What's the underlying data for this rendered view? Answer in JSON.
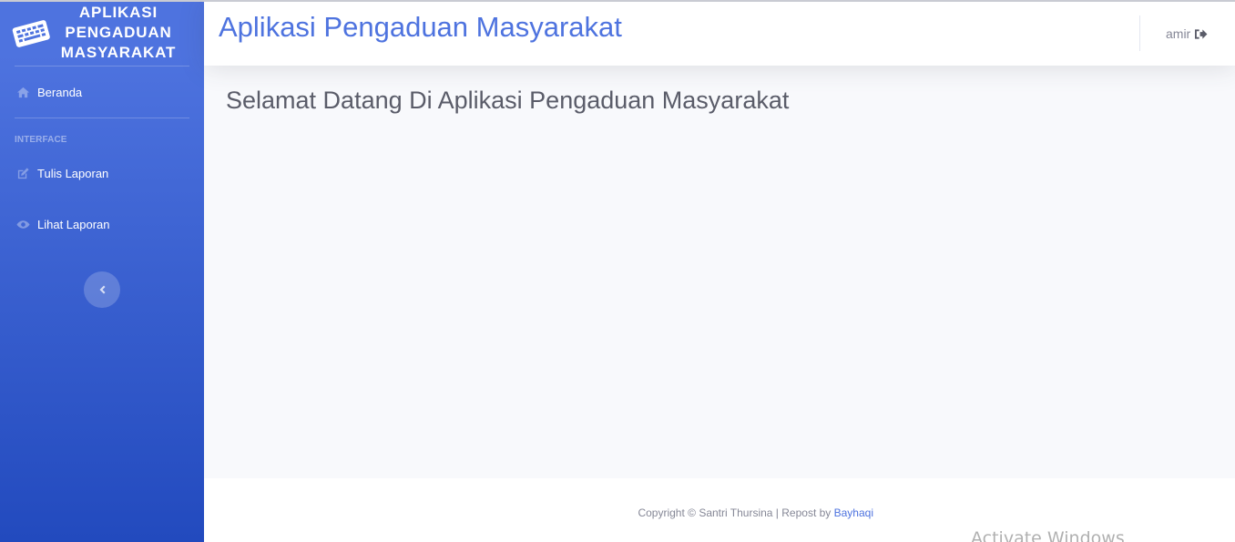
{
  "sidebar": {
    "brand": {
      "icon": "keyboard-icon",
      "line1": "APLIKASI",
      "line2": "PENGADUAN",
      "line3": "MASYARAKAT"
    },
    "items": [
      {
        "label": "Beranda",
        "icon": "home-icon"
      },
      {
        "label": "Tulis Laporan",
        "icon": "edit-icon"
      },
      {
        "label": "Lihat Laporan",
        "icon": "eye-icon"
      }
    ],
    "heading": "INTERFACE",
    "toggle_icon": "chevron-left-icon",
    "gradient_start": "#4e73df",
    "gradient_end": "#224abe"
  },
  "topbar": {
    "title": "Aplikasi Pengaduan Masyarakat",
    "user": "amir",
    "logout_icon": "sign-out-icon",
    "title_color": "#4e73df"
  },
  "main": {
    "welcome": "Selamat Datang Di Aplikasi Pengaduan Masyarakat"
  },
  "footer": {
    "copyright_prefix": "Copyright © Santri Thursina | Repost by ",
    "link_text": "Bayhaqi"
  },
  "overlay": {
    "watermark": "Activate Windows"
  }
}
